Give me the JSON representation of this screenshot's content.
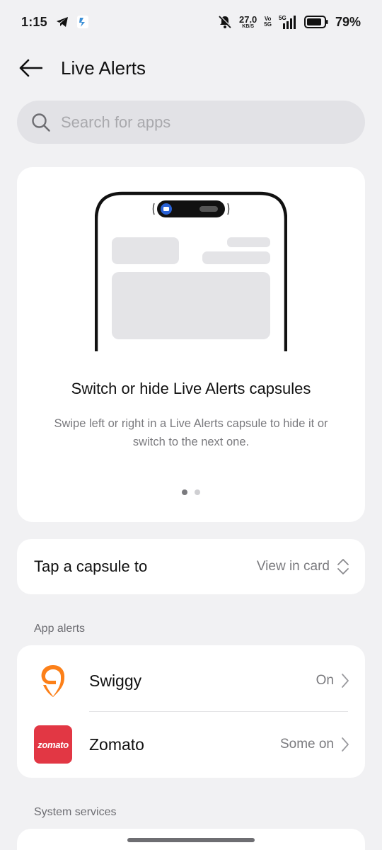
{
  "status_bar": {
    "time": "1:15",
    "speed_value": "27.0",
    "speed_unit": "KB/S",
    "vo_top": "Vo",
    "vo_bottom": "5G",
    "network": "5G",
    "battery": "79%"
  },
  "header": {
    "title": "Live Alerts",
    "back_icon": "arrow-left-icon"
  },
  "search": {
    "placeholder": "Search for apps",
    "icon": "search-icon"
  },
  "promo": {
    "title": "Switch or hide Live Alerts capsules",
    "description": "Swipe left or right in a Live Alerts capsule to hide it or switch to the next one.",
    "page_index": 1,
    "page_count": 2
  },
  "capsule_setting": {
    "label": "Tap a capsule to",
    "value": "View in card"
  },
  "sections": {
    "app_alerts": "App alerts",
    "system_services": "System services"
  },
  "apps": [
    {
      "name": "Swiggy",
      "status": "On",
      "icon": "swiggy-logo-icon",
      "color": "#fc8019"
    },
    {
      "name": "Zomato",
      "status": "Some on",
      "icon": "zomato-logo-icon",
      "color": "#e23744",
      "logo_text": "zomato"
    }
  ]
}
